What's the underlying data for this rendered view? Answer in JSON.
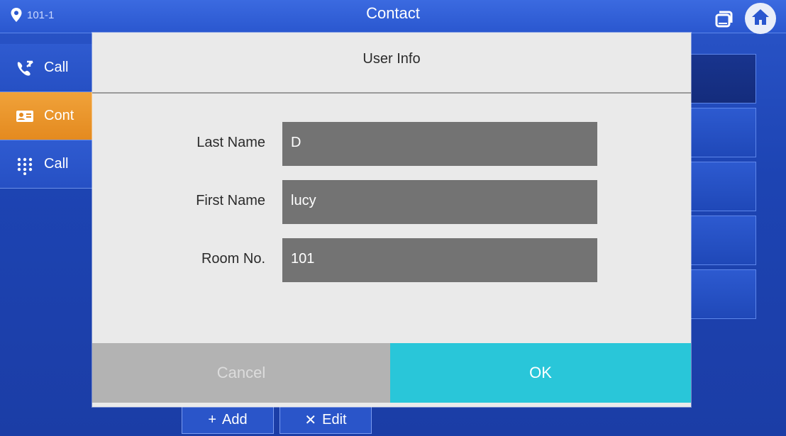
{
  "header": {
    "location": "101-1",
    "title": "Contact",
    "icons": [
      "location-pin-icon",
      "window-icon",
      "home-icon"
    ]
  },
  "sidebar": {
    "items": [
      {
        "label": "Call",
        "icon": "call-log-icon",
        "active": false
      },
      {
        "label": "Cont",
        "icon": "contact-card-icon",
        "active": true
      },
      {
        "label": "Call",
        "icon": "dialpad-icon",
        "active": false
      }
    ]
  },
  "toolbar": {
    "add_label": "Add",
    "edit_label": "Edit"
  },
  "dialog": {
    "title": "User Info",
    "fields": [
      {
        "label": "Last Name",
        "value": "D"
      },
      {
        "label": "First Name",
        "value": "lucy"
      },
      {
        "label": "Room No.",
        "value": "101"
      }
    ],
    "cancel_label": "Cancel",
    "ok_label": "OK"
  },
  "colors": {
    "accent": "#29c6d9",
    "active_tab": "#e48a1f",
    "background": "#1d44b3",
    "dialog_bg": "#eaeaea",
    "input_bg": "#737373"
  }
}
